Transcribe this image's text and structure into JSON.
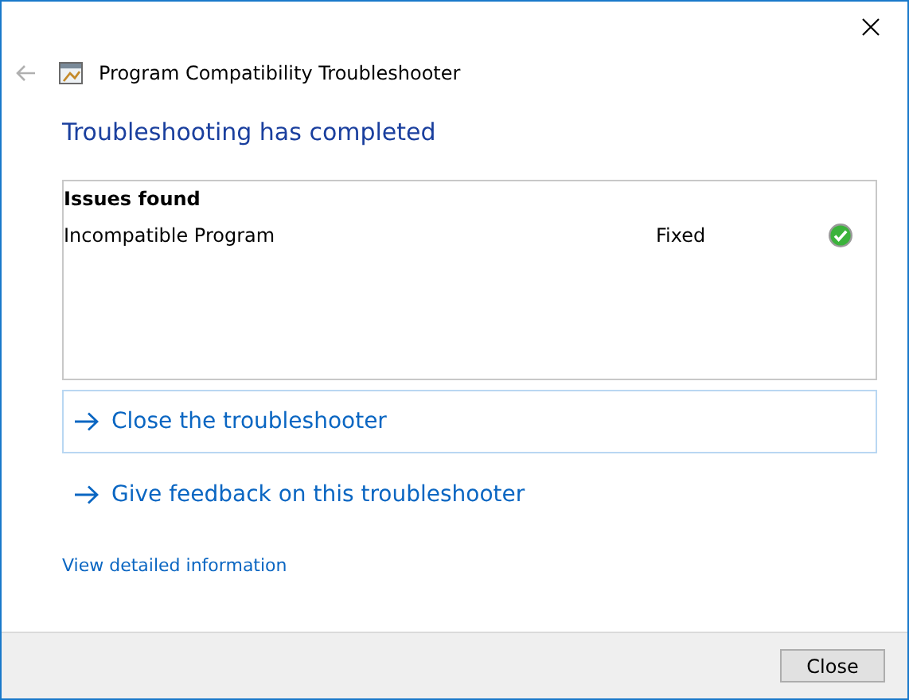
{
  "window": {
    "title": "Program Compatibility Troubleshooter"
  },
  "heading": "Troubleshooting has completed",
  "issues": {
    "columns": [
      "Issues found"
    ],
    "rows": [
      {
        "name": "Incompatible Program",
        "status": "Fixed",
        "kind": "ok"
      }
    ]
  },
  "options": [
    {
      "label": "Close the troubleshooter",
      "selected": true
    },
    {
      "label": "Give feedback on this troubleshooter",
      "selected": false
    }
  ],
  "details_link": "View detailed information",
  "buttons": [
    "Close"
  ]
}
